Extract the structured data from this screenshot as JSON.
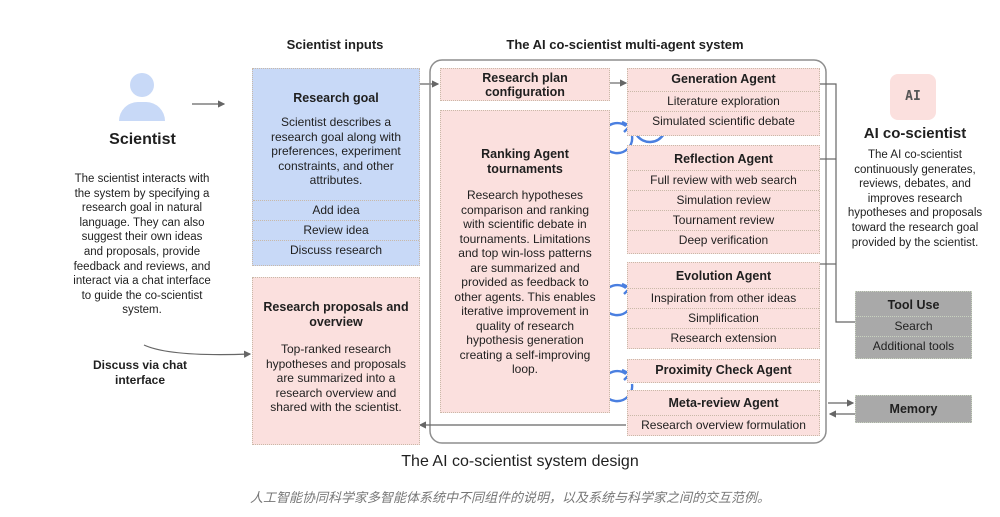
{
  "scientist": {
    "title": "Scientist",
    "icon": "person-icon",
    "description": "The scientist interacts with the system by specifying a research goal in natural language. They can also suggest their own ideas and proposals, provide feedback and reviews, and interact via a chat interface to guide the co-scientist system.",
    "chat_label": "Discuss via chat interface"
  },
  "inputs": {
    "header": "Scientist inputs",
    "research_goal": {
      "title": "Research goal",
      "description": "Scientist describes a research goal along with preferences, experiment constraints, and other attributes.",
      "actions": [
        "Add idea",
        "Review idea",
        "Discuss research"
      ]
    },
    "proposals": {
      "title": "Research proposals and overview",
      "description": "Top-ranked research hypotheses and proposals are summarized into a research overview and shared with the scientist."
    }
  },
  "system": {
    "header": "The AI co-scientist multi-agent system",
    "plan_config": "Research plan configuration",
    "ranking": {
      "title": "Ranking Agent tournaments",
      "description": "Research hypotheses comparison and ranking with scientific debate in tournaments. Limitations and top win-loss patterns are summarized and provided as feedback to other agents. This enables iterative improvement in quality of research hypothesis generation creating a self-improving  loop."
    },
    "agents": [
      {
        "title": "Generation Agent",
        "items": [
          "Literature exploration",
          "Simulated scientific debate"
        ]
      },
      {
        "title": "Reflection Agent",
        "items": [
          "Full review with web search",
          "Simulation review",
          "Tournament review",
          "Deep verification"
        ]
      },
      {
        "title": "Evolution Agent",
        "items": [
          "Inspiration from other ideas",
          "Simplification",
          "Research extension"
        ]
      },
      {
        "title": "Proximity Check Agent",
        "items": []
      },
      {
        "title": "Meta-review Agent",
        "items": [
          "Research overview formulation"
        ]
      }
    ]
  },
  "ai": {
    "badge": "AI",
    "title": "AI co-scientist",
    "description": "The AI co-scientist continuously generates, reviews, debates, and improves research hypotheses and proposals toward the research goal provided by the scientist."
  },
  "tools": {
    "title": "Tool Use",
    "items": [
      "Search",
      "Additional tools"
    ]
  },
  "memory": {
    "title": "Memory"
  },
  "caption": "The AI co-scientist system design",
  "subcaption": "人工智能协同科学家多智能体系统中不同组件的说明，以及系统与科学家之间的交互范例。",
  "colors": {
    "pink": "#fbe0de",
    "blue": "#c8d9f7",
    "gray": "#a9a9a9",
    "loop_arrow": "#4a7fe0",
    "person": "#c8d9f7"
  }
}
